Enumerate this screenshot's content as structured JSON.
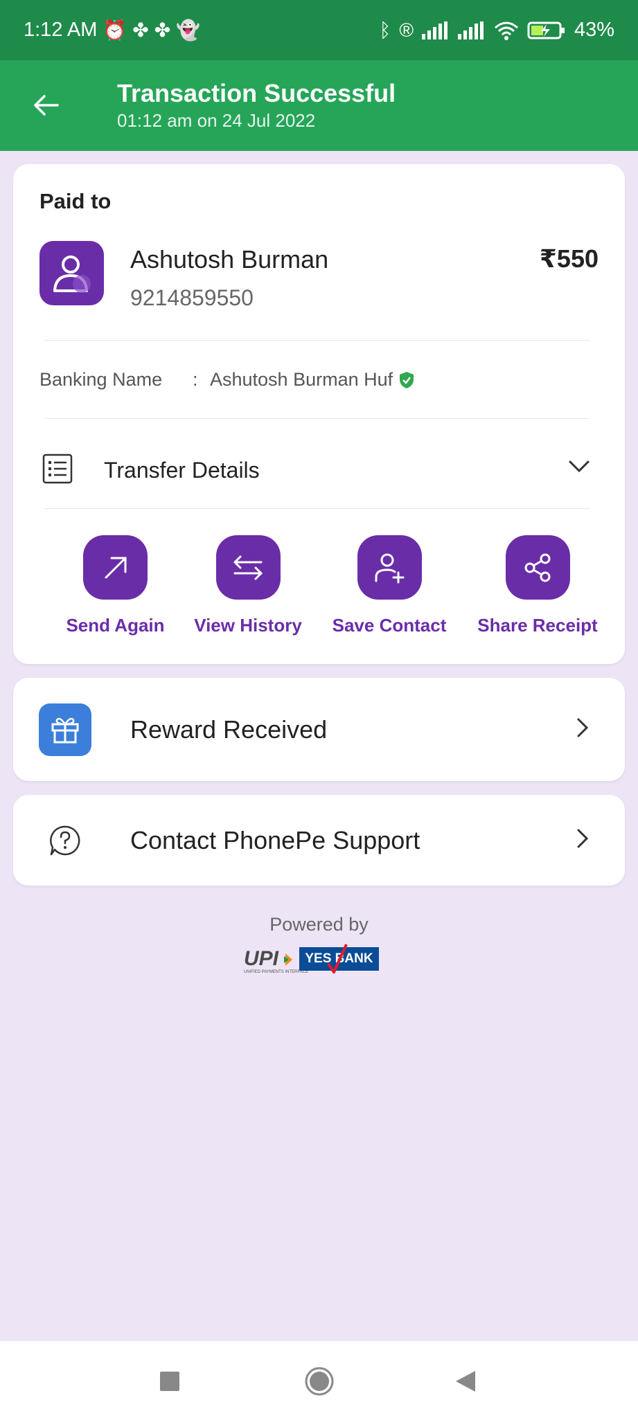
{
  "status_bar": {
    "time": "1:12 AM",
    "battery": "43%",
    "icons": [
      "alarm-icon",
      "app-notification-icon",
      "app-notification-icon",
      "snapchat-icon",
      "bluetooth-icon",
      "registered-icon",
      "signal-icon",
      "signal-icon",
      "wifi-icon",
      "battery-charging-icon"
    ]
  },
  "header": {
    "title": "Transaction Successful",
    "subtitle": "01:12 am on 24 Jul 2022",
    "back_icon": "arrow-left-icon",
    "color": "#26a558"
  },
  "payment": {
    "paid_to_label": "Paid to",
    "name": "Ashutosh Burman",
    "phone": "9214859550",
    "amount": "₹550",
    "banking_name_label": "Banking Name",
    "separator": ":",
    "banking_name": "Ashutosh Burman Huf",
    "verified_icon": "verified-shield-icon"
  },
  "transfer_details": {
    "label": "Transfer Details"
  },
  "actions": [
    {
      "label": "Send Again",
      "icon": "arrow-up-right-icon"
    },
    {
      "label": "View History",
      "icon": "swap-arrows-icon"
    },
    {
      "label": "Save Contact",
      "icon": "add-person-icon"
    },
    {
      "label": "Share Receipt",
      "icon": "share-icon"
    }
  ],
  "reward": {
    "label": "Reward Received",
    "icon": "gift-icon"
  },
  "support": {
    "label": "Contact PhonePe Support",
    "icon": "help-chat-icon"
  },
  "footer": {
    "powered_by": "Powered by",
    "upi_text": "UPI",
    "upi_subtext": "UNIFIED PAYMENTS INTERFACE",
    "bank_text": "YES BANK"
  },
  "colors": {
    "accent_purple": "#6a2da8",
    "status_green": "#1f8b4a",
    "background": "#ede4f6",
    "reward_blue": "#3b7fdb"
  }
}
